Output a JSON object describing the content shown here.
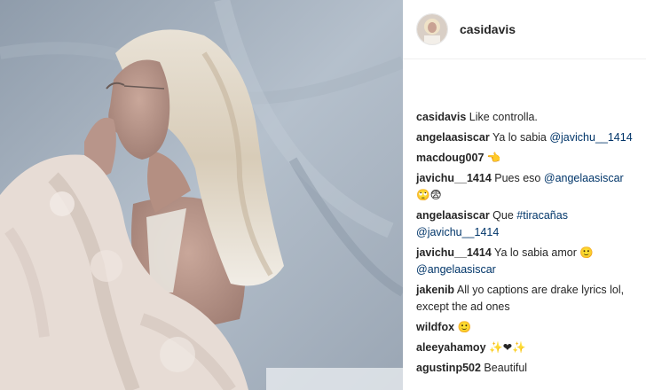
{
  "post": {
    "author": "casidavis"
  },
  "comments": [
    {
      "user": "casidavis",
      "parts": [
        {
          "t": "text",
          "v": " Like controlla."
        }
      ]
    },
    {
      "user": "angelaasiscar",
      "parts": [
        {
          "t": "text",
          "v": " Ya lo sabia "
        },
        {
          "t": "tag",
          "v": "@javichu__1414"
        }
      ]
    },
    {
      "user": "macdoug007",
      "parts": [
        {
          "t": "text",
          "v": " 👈"
        }
      ]
    },
    {
      "user": "javichu__1414",
      "parts": [
        {
          "t": "text",
          "v": " Pues eso "
        },
        {
          "t": "tag",
          "v": "@angelaasiscar"
        },
        {
          "t": "text",
          "v": " 🙄😨"
        }
      ]
    },
    {
      "user": "angelaasiscar",
      "parts": [
        {
          "t": "text",
          "v": " Que "
        },
        {
          "t": "tag",
          "v": "#tiracañas"
        },
        {
          "t": "text",
          "v": " "
        },
        {
          "t": "tag",
          "v": "@javichu__1414"
        }
      ]
    },
    {
      "user": "javichu__1414",
      "parts": [
        {
          "t": "text",
          "v": " Ya lo sabia amor 🙂 "
        },
        {
          "t": "tag",
          "v": "@angelaasiscar"
        }
      ]
    },
    {
      "user": "jakenib",
      "parts": [
        {
          "t": "text",
          "v": " All yo captions are drake lyrics lol, except the ad ones"
        }
      ]
    },
    {
      "user": "wildfox",
      "parts": [
        {
          "t": "text",
          "v": " 🙂"
        }
      ]
    },
    {
      "user": "aleeyahamoy",
      "parts": [
        {
          "t": "text",
          "v": " ✨❤✨"
        }
      ]
    },
    {
      "user": "agustinp502",
      "parts": [
        {
          "t": "text",
          "v": " Beautiful"
        }
      ]
    }
  ]
}
